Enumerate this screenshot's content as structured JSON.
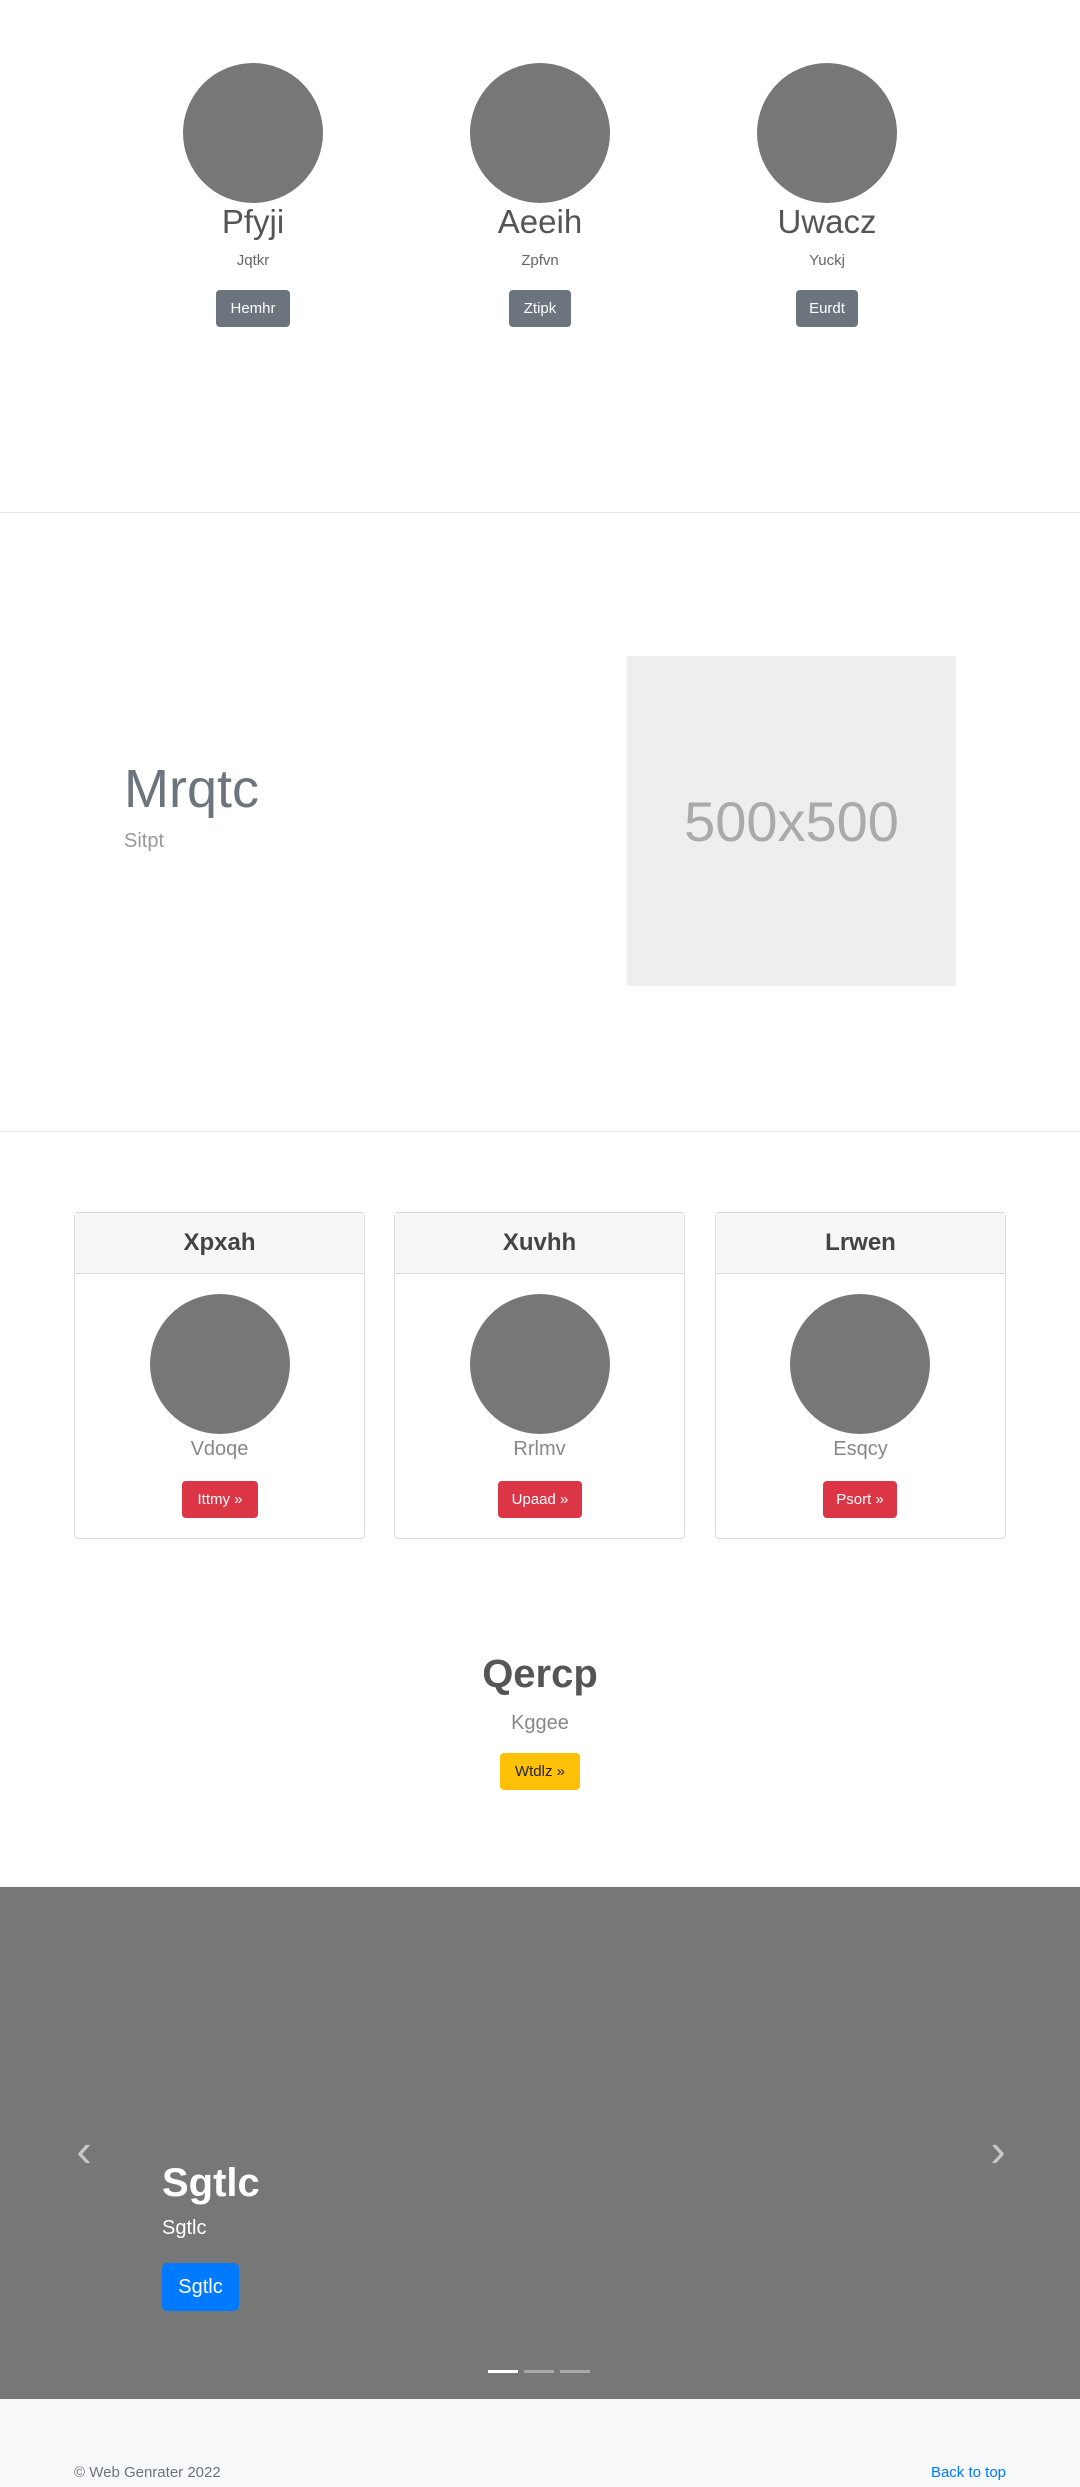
{
  "team": [
    {
      "name": "Pfyji",
      "role": "Jqtkr",
      "button": "Hemhr"
    },
    {
      "name": "Aeeih",
      "role": "Zpfvn",
      "button": "Ztipk"
    },
    {
      "name": "Uwacz",
      "role": "Yuckj",
      "button": "Eurdt"
    }
  ],
  "feature": {
    "title": "Mrqtc",
    "subtitle": "Sitpt",
    "placeholder_label": "500x500"
  },
  "cards": [
    {
      "header": "Xpxah",
      "caption": "Vdoqe",
      "button": "Ittmy »"
    },
    {
      "header": "Xuvhh",
      "caption": "Rrlmv",
      "button": "Upaad »"
    },
    {
      "header": "Lrwen",
      "caption": "Esqcy",
      "button": "Psort »"
    }
  ],
  "cta": {
    "title": "Qercp",
    "subtitle": "Kggee",
    "button": "Wtdlz »"
  },
  "carousel": {
    "title": "Sgtlc",
    "subtitle": "Sgtlc",
    "button": "Sgtlc",
    "prev": "‹",
    "next": "›",
    "active_indicator": 1,
    "indicator_count": 3
  },
  "footer": {
    "copyright": "© Web Genrater 2022",
    "back_to_top": "Back to top"
  }
}
